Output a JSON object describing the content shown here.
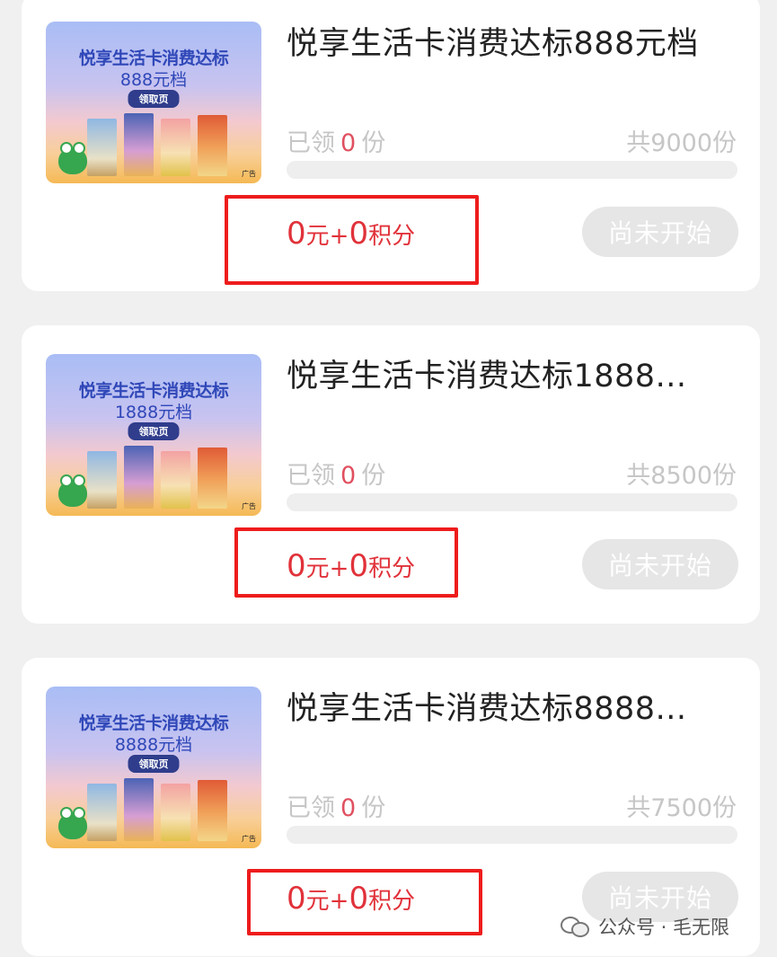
{
  "cards": [
    {
      "thumb_title": "悦享生活卡消费达标",
      "thumb_tier": "888元档",
      "thumb_tag": "领取页",
      "thumb_ad": "广告",
      "title": "悦享生活卡消费达标888元档",
      "claimed_prefix": "已领",
      "claimed_count": "0",
      "claimed_suffix": "份",
      "total": "共9000份",
      "progress": 0,
      "price_yuan": "0",
      "price_yuan_unit": "元",
      "price_plus": "+",
      "price_points": "0",
      "price_points_unit": "积分",
      "button": "尚未开始"
    },
    {
      "thumb_title": "悦享生活卡消费达标",
      "thumb_tier": "1888元档",
      "thumb_tag": "领取页",
      "thumb_ad": "广告",
      "title": "悦享生活卡消费达标1888...",
      "claimed_prefix": "已领",
      "claimed_count": "0",
      "claimed_suffix": "份",
      "total": "共8500份",
      "progress": 0,
      "price_yuan": "0",
      "price_yuan_unit": "元",
      "price_plus": "+",
      "price_points": "0",
      "price_points_unit": "积分",
      "button": "尚未开始"
    },
    {
      "thumb_title": "悦享生活卡消费达标",
      "thumb_tier": "8888元档",
      "thumb_tag": "领取页",
      "thumb_ad": "广告",
      "title": "悦享生活卡消费达标8888...",
      "claimed_prefix": "已领",
      "claimed_count": "0",
      "claimed_suffix": "份",
      "total": "共7500份",
      "progress": 0,
      "price_yuan": "0",
      "price_yuan_unit": "元",
      "price_plus": "+",
      "price_points": "0",
      "price_points_unit": "积分",
      "button": "尚未开始"
    }
  ],
  "watermark": "公众号 · 毛无限",
  "colors": {
    "price": "#e1323a",
    "highlight_box": "#ee1c1c",
    "button_disabled": "#e6e6e6"
  }
}
